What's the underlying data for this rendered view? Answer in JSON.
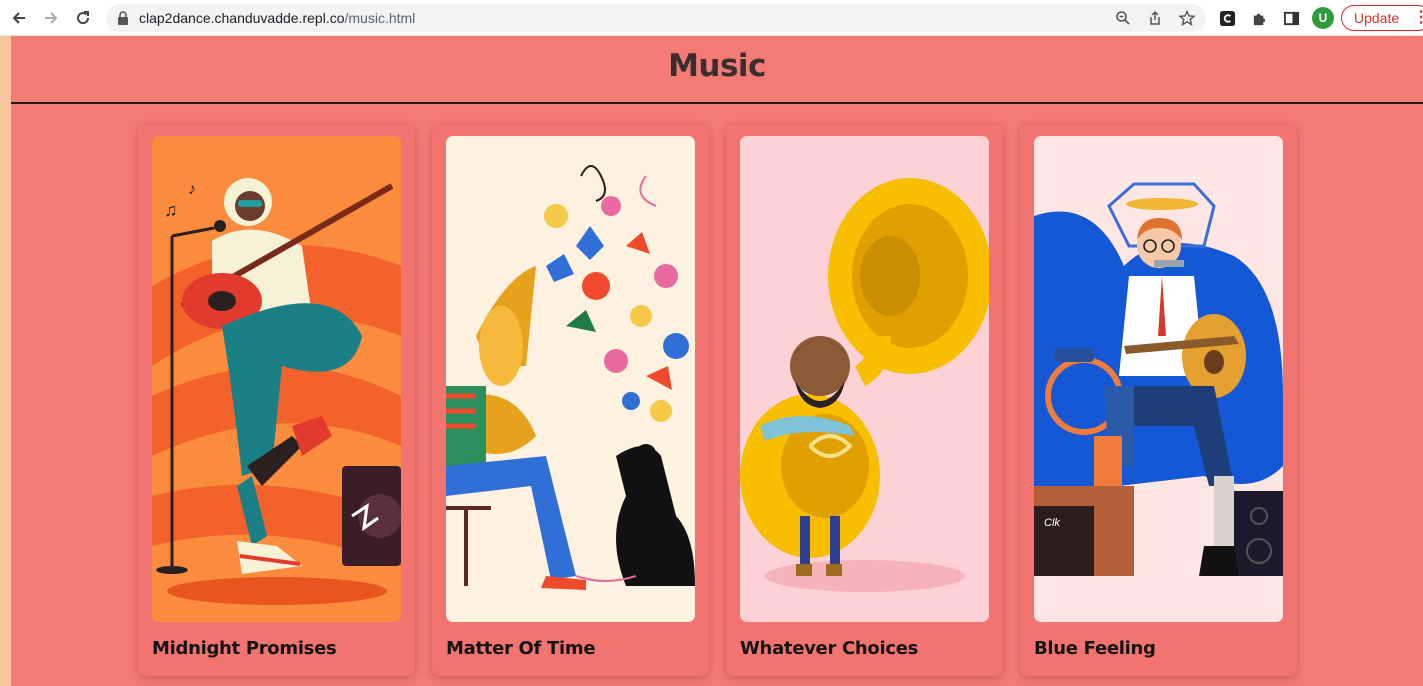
{
  "browser": {
    "url_host": "clap2dance.chanduvadde.repl.co",
    "url_path": "/music.html",
    "profile_initial": "U",
    "update_label": "Update",
    "icons": [
      "back-arrow-icon",
      "forward-arrow-icon",
      "reload-icon",
      "lock-icon",
      "zoom-icon",
      "share-icon",
      "bookmark-star-icon",
      "extension-c-icon",
      "puzzle-extensions-icon",
      "side-panel-icon",
      "kebab-menu-icon"
    ]
  },
  "page": {
    "title": "Music",
    "accent_bg": "#f47a76",
    "songs": [
      {
        "title": "Midnight Promises",
        "art": "guitarist-illustration"
      },
      {
        "title": "Matter Of Time",
        "art": "horn-player-flowers-illustration"
      },
      {
        "title": "Whatever Choices",
        "art": "tuba-player-illustration"
      },
      {
        "title": "Blue Feeling",
        "art": "one-man-band-illustration"
      }
    ]
  }
}
